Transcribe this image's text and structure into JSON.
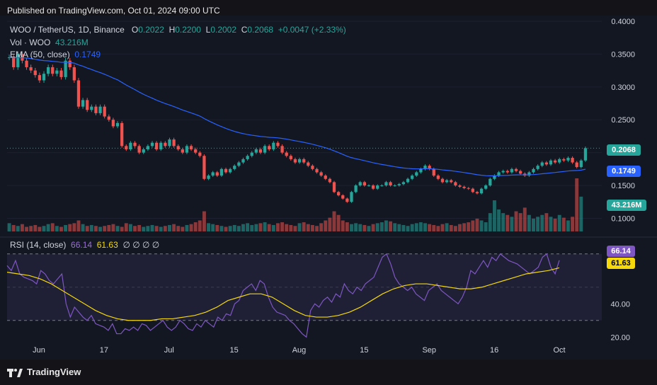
{
  "header": {
    "published": "Published on TradingView.com, Oct 01, 2024 09:00 UTC"
  },
  "legend": {
    "symbol": "WOO / TetherUS, 1D, Binance",
    "o_label": "O",
    "o_value": "0.2022",
    "h_label": "H",
    "h_value": "0.2200",
    "l_label": "L",
    "l_value": "0.2002",
    "c_label": "C",
    "c_value": "0.2068",
    "change": "+0.0047 (+2.33%)",
    "vol_label": "Vol · WOO",
    "vol_value": "43.216M",
    "ema_label": "EMA (50, close)",
    "ema_value": "0.1749",
    "rsi_label": "RSI (14, close)",
    "rsi_value": "66.14",
    "rsi_ma_value": "61.63",
    "rsi_extra": "∅ ∅ ∅ ∅"
  },
  "price_tags": {
    "last": "0.2068",
    "ema": "0.1749",
    "volume": "43.216M"
  },
  "rsi_tags": {
    "rsi": "66.14",
    "ma": "61.63"
  },
  "footer": {
    "brand": "TradingView"
  },
  "colors": {
    "up": "#26a69a",
    "down": "#ef5350",
    "ema": "#2962ff",
    "rsi": "#7e57c2",
    "rsi_ma": "#f5d90a"
  },
  "chart_data": [
    {
      "type": "candlestick",
      "title": "WOO / TetherUS, 1D, Binance",
      "x_ticks": [
        "Jun",
        "17",
        "Jul",
        "15",
        "Aug",
        "15",
        "Sep",
        "16",
        "Oct"
      ],
      "y_ticks": [
        "0.4000",
        "0.3500",
        "0.3000",
        "0.2500",
        "0.2000",
        "0.1500",
        "0.1000"
      ],
      "ylim": [
        0.08,
        0.4
      ],
      "series_close": [
        0.345,
        0.33,
        0.35,
        0.34,
        0.33,
        0.325,
        0.318,
        0.31,
        0.32,
        0.33,
        0.32,
        0.325,
        0.315,
        0.34,
        0.33,
        0.31,
        0.27,
        0.28,
        0.265,
        0.27,
        0.26,
        0.27,
        0.255,
        0.25,
        0.24,
        0.245,
        0.21,
        0.205,
        0.215,
        0.21,
        0.2,
        0.205,
        0.21,
        0.215,
        0.205,
        0.215,
        0.21,
        0.22,
        0.21,
        0.205,
        0.2,
        0.21,
        0.205,
        0.2,
        0.195,
        0.16,
        0.165,
        0.17,
        0.165,
        0.175,
        0.17,
        0.175,
        0.18,
        0.185,
        0.19,
        0.195,
        0.2,
        0.205,
        0.2,
        0.21,
        0.205,
        0.215,
        0.21,
        0.2,
        0.195,
        0.19,
        0.185,
        0.19,
        0.185,
        0.18,
        0.175,
        0.17,
        0.165,
        0.16,
        0.155,
        0.14,
        0.135,
        0.13,
        0.125,
        0.14,
        0.15,
        0.155,
        0.15,
        0.15,
        0.145,
        0.15,
        0.15,
        0.155,
        0.15,
        0.15,
        0.152,
        0.155,
        0.16,
        0.165,
        0.17,
        0.175,
        0.18,
        0.175,
        0.165,
        0.16,
        0.155,
        0.158,
        0.155,
        0.15,
        0.148,
        0.146,
        0.145,
        0.14,
        0.138,
        0.145,
        0.15,
        0.16,
        0.165,
        0.17,
        0.172,
        0.17,
        0.175,
        0.172,
        0.168,
        0.165,
        0.17,
        0.175,
        0.18,
        0.185,
        0.182,
        0.188,
        0.185,
        0.19,
        0.188,
        0.192,
        0.185,
        0.178,
        0.188,
        0.2068
      ],
      "ema_end": 0.1749,
      "last_close": 0.2068
    },
    {
      "type": "line",
      "title": "RSI (14, close)",
      "y_ticks": [
        "40.00",
        "20.00"
      ],
      "ylim": [
        15,
        78
      ],
      "bands": [
        70,
        50,
        30
      ],
      "series": [
        {
          "name": "RSI",
          "values": [
            63,
            60,
            66,
            58,
            56,
            55,
            54,
            52,
            60,
            58,
            54,
            52,
            55,
            58,
            40,
            32,
            38,
            35,
            32,
            30,
            33,
            28,
            27,
            26,
            24,
            28,
            22,
            22,
            25,
            24,
            26,
            24,
            28,
            27,
            24,
            26,
            28,
            30,
            26,
            24,
            26,
            30,
            28,
            25,
            24,
            28,
            26,
            30,
            28,
            26,
            32,
            30,
            34,
            33,
            40,
            42,
            48,
            50,
            52,
            48,
            54,
            52,
            44,
            38,
            35,
            34,
            33,
            30,
            28,
            25,
            22,
            20,
            36,
            40,
            38,
            42,
            44,
            41,
            46,
            44,
            52,
            48,
            46,
            50,
            48,
            52,
            54,
            56,
            62,
            68,
            70,
            64,
            56,
            52,
            50,
            48,
            50,
            46,
            44,
            42,
            48,
            50,
            52,
            48,
            46,
            44,
            42,
            40,
            44,
            50,
            60,
            58,
            62,
            66,
            62,
            68,
            66,
            70,
            68,
            66,
            65,
            64,
            62,
            60,
            58,
            60,
            62,
            68,
            70,
            62,
            58,
            66.14
          ]
        },
        {
          "name": "RSI MA",
          "values": [
            59,
            58,
            57,
            55,
            52,
            48,
            44,
            40,
            36,
            33,
            31,
            30,
            30,
            30,
            31,
            31,
            32,
            33,
            35,
            38,
            42,
            44,
            46,
            46,
            44,
            40,
            36,
            33,
            32,
            32,
            33,
            35,
            38,
            42,
            46,
            49,
            51,
            52,
            52,
            51,
            50,
            49,
            49,
            50,
            52,
            54,
            56,
            58,
            59,
            60,
            61.63
          ]
        }
      ]
    },
    {
      "type": "bar",
      "title": "Vol · WOO",
      "series": [
        {
          "name": "Volume",
          "values": [
            9,
            7,
            6,
            8,
            5,
            6,
            7,
            5,
            6,
            8,
            9,
            6,
            5,
            7,
            8,
            9,
            12,
            8,
            6,
            7,
            6,
            5,
            6,
            7,
            8,
            6,
            5,
            9,
            8,
            6,
            7,
            5,
            6,
            7,
            6,
            5,
            6,
            7,
            8,
            6,
            5,
            7,
            8,
            10,
            12,
            22,
            9,
            8,
            7,
            6,
            5,
            6,
            7,
            6,
            8,
            9,
            7,
            8,
            9,
            10,
            8,
            7,
            9,
            10,
            8,
            7,
            6,
            9,
            10,
            8,
            7,
            6,
            9,
            12,
            15,
            22,
            18,
            12,
            10,
            8,
            9,
            8,
            7,
            6,
            8,
            9,
            10,
            12,
            11,
            9,
            8,
            7,
            6,
            8,
            9,
            10,
            9,
            8,
            7,
            6,
            8,
            9,
            7,
            6,
            8,
            9,
            10,
            12,
            14,
            12,
            10,
            20,
            34,
            24,
            20,
            18,
            16,
            22,
            20,
            26,
            18,
            14,
            16,
            18,
            20,
            16,
            14,
            18,
            15,
            12,
            16,
            58,
            38
          ]
        }
      ]
    }
  ]
}
